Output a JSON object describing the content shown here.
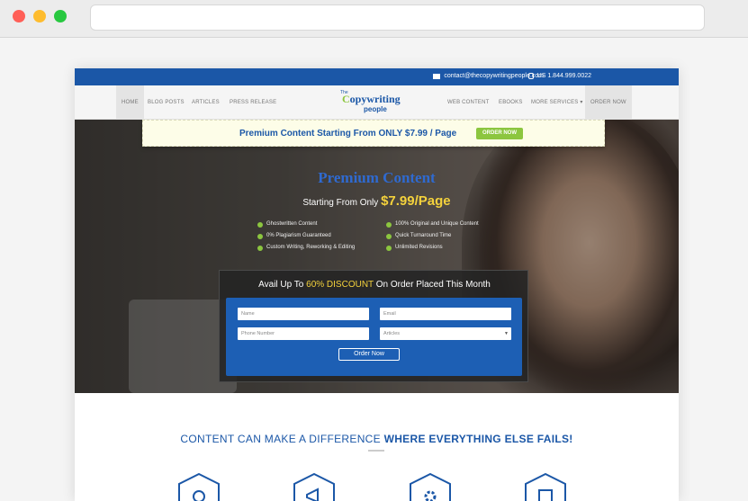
{
  "topbar": {
    "email": "contact@thecopywritingpeople.com",
    "phone": "US 1.844.999.0022"
  },
  "nav": {
    "left": [
      "HOME",
      "BLOG POSTS",
      "ARTICLES",
      "PRESS RELEASE"
    ],
    "right": [
      "WEB CONTENT",
      "EBOOKS",
      "MORE SERVICES ▾",
      "ORDER NOW"
    ]
  },
  "logo": {
    "small": "The",
    "main_a": "C",
    "main_b": "opywriting",
    "sub": "people"
  },
  "banner": {
    "text": "Premium Content Starting From ONLY $7.99 / Page",
    "button": "ORDER NOW"
  },
  "hero": {
    "title": "Premium Content",
    "subtitle": "Starting From Only",
    "price": "$7.99/Page",
    "features_left": [
      "Ghostwritten Content",
      "0% Plagiarism Guaranteed",
      "Custom Writing, Reworking & Editing"
    ],
    "features_right": [
      "100% Original and Unique Content",
      "Quick Turnaround Time",
      "Unlimited Revisions"
    ]
  },
  "form": {
    "head_a": "Avail Up To ",
    "head_discount": "60% DISCOUNT",
    "head_b": " On Order Placed This Month",
    "name_placeholder": "Name",
    "email_placeholder": "Email",
    "phone_placeholder": "Phone Number",
    "type_selected": "Articles",
    "submit": "Order Now"
  },
  "tagline": {
    "a": "CONTENT CAN MAKE A DIFFERENCE ",
    "b": "WHERE EVERYTHING ELSE FAILS!"
  },
  "colors": {
    "brand_blue": "#1b57a7",
    "accent_green": "#8cc63f",
    "highlight_yellow": "#f4d23c"
  }
}
